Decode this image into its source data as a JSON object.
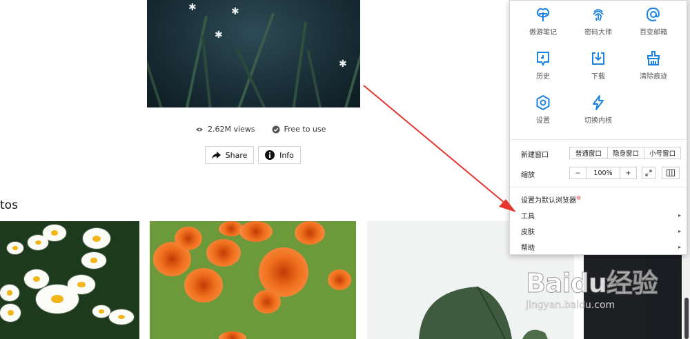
{
  "hero": {
    "views": "2.62M views",
    "license": "Free to use"
  },
  "actions": {
    "share_label": "Share",
    "info_label": "Info"
  },
  "section": {
    "heading": "tos"
  },
  "menu": {
    "grid": [
      {
        "label": "傲游笔记",
        "icon": "notes-icon"
      },
      {
        "label": "密码大师",
        "icon": "fingerprint-icon"
      },
      {
        "label": "百变邮箱",
        "icon": "mail-at-icon"
      },
      {
        "label": "历史",
        "icon": "history-icon"
      },
      {
        "label": "下载",
        "icon": "download-icon"
      },
      {
        "label": "清除痕迹",
        "icon": "clear-traces-icon"
      },
      {
        "label": "设置",
        "icon": "settings-gear-icon"
      },
      {
        "label": "切换内核",
        "icon": "lightning-icon"
      }
    ],
    "new_window_label": "新建窗口",
    "window_options": [
      "普通窗口",
      "隐身窗口",
      "小号窗口"
    ],
    "zoom_label": "缩放",
    "zoom_minus": "−",
    "zoom_value": "100%",
    "zoom_plus": "+",
    "set_default": "设置为默认浏览器",
    "tools": "工具",
    "skins": "皮肤",
    "help": "帮助",
    "accent_color": "#1a82e2"
  },
  "watermark": {
    "logo": "Baidu经验",
    "domain": "jingyan.baidu.com"
  }
}
